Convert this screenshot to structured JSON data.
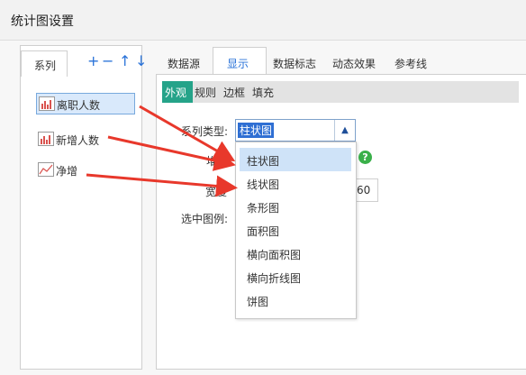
{
  "title": "统计图设置",
  "left_tab": "系列",
  "toolbar": {
    "add": "+",
    "remove": "−",
    "up": "↑",
    "down": "↓"
  },
  "tabs": [
    "数据源",
    "显示",
    "数据标志",
    "动态效果",
    "参考线"
  ],
  "active_tab": "显示",
  "series": [
    {
      "label": "离职人数",
      "icon": "bar-chart-icon",
      "selected": true
    },
    {
      "label": "新增人数",
      "icon": "bar-chart-icon",
      "selected": false
    },
    {
      "label": "净增",
      "icon": "line-chart-icon",
      "selected": false
    }
  ],
  "subtabs": [
    "外观",
    "规则",
    "边框",
    "填充"
  ],
  "form": {
    "series_type_label": "系列类型:",
    "series_type_value": "柱状图",
    "stack_label": "堆积",
    "width_label": "宽度",
    "width_value": "60",
    "legend_label": "选中图例:"
  },
  "dropdown_options": [
    "柱状图",
    "线状图",
    "条形图",
    "面积图",
    "横向面积图",
    "横向折线图",
    "饼图"
  ],
  "colors": {
    "accent": "#2a73d9",
    "active_subtab": "#25a389",
    "arrow": "#e8382b"
  }
}
